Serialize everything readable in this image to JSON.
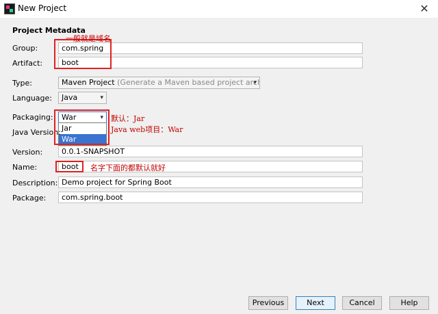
{
  "window": {
    "title": "New Project",
    "close_symbol": "✕"
  },
  "section_title": "Project Metadata",
  "fields": {
    "group": {
      "label": "Group:",
      "value": "com.spring"
    },
    "artifact": {
      "label": "Artifact:",
      "value": "boot"
    },
    "type": {
      "label": "Type:",
      "value": "Maven Project",
      "hint": "(Generate a Maven based project archive)"
    },
    "language": {
      "label": "Language:",
      "value": "Java"
    },
    "packaging": {
      "label": "Packaging:",
      "value": "War",
      "options": [
        "Jar",
        "War"
      ],
      "selected": "War"
    },
    "java_version": {
      "label": "Java Version:"
    },
    "version": {
      "label": "Version:",
      "value": "0.0.1-SNAPSHOT"
    },
    "name": {
      "label": "Name:",
      "value": "boot"
    },
    "description": {
      "label": "Description:",
      "value": "Demo project for Spring Boot"
    },
    "package": {
      "label": "Package:",
      "value": "com.spring.boot"
    }
  },
  "annotations": {
    "group_note": "一般就是域名",
    "packaging_default": "默认：Jar",
    "packaging_web": "Java web项目：War",
    "name_note": "名字下面的都默认就好"
  },
  "buttons": {
    "previous": "Previous",
    "next": "Next",
    "cancel": "Cancel",
    "help": "Help"
  },
  "icons": {
    "dropdown_arrow": "▾"
  },
  "colors": {
    "annotation": "#c00000",
    "highlight_box": "#e02020",
    "selection": "#3874d0"
  }
}
